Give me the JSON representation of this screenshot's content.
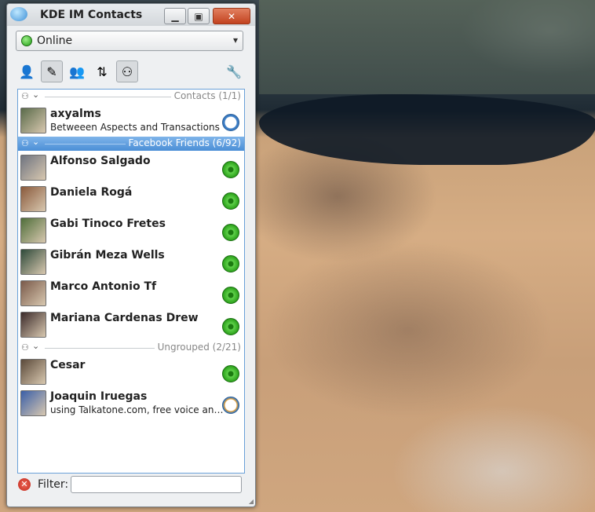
{
  "window": {
    "title": "KDE IM Contacts",
    "min_icon": "minimize-icon",
    "max_icon": "maximize-icon",
    "close_icon": "close-icon"
  },
  "status": {
    "value": "Online",
    "color": "#2ca11b"
  },
  "toolbar": {
    "icons": [
      "add-contact-icon",
      "edit-icon",
      "show-offline-icon",
      "sort-icon",
      "group-view-icon",
      "settings-icon"
    ]
  },
  "groups": [
    {
      "label": "Contacts (1/1)",
      "selected": false,
      "contacts": [
        {
          "name": "axyalms",
          "message": "Betweeen Aspects and Transactions",
          "status": "away",
          "avatar": "#5a6b4a"
        }
      ]
    },
    {
      "label": "Facebook Friends (6/92)",
      "selected": true,
      "contacts": [
        {
          "name": "Alfonso Salgado",
          "message": "",
          "status": "online",
          "avatar": "#6f7480"
        },
        {
          "name": "Daniela Rogá",
          "message": "",
          "status": "online",
          "avatar": "#8a5a3c"
        },
        {
          "name": "Gabi Tinoco Fretes",
          "message": "",
          "status": "online",
          "avatar": "#4f6e3a"
        },
        {
          "name": "Gibrán Meza Wells",
          "message": "",
          "status": "online",
          "avatar": "#2e4a3a"
        },
        {
          "name": "Marco Antonio Tf",
          "message": "",
          "status": "online",
          "avatar": "#7a5a4a"
        },
        {
          "name": "Mariana Cardenas Drew",
          "message": "",
          "status": "online",
          "avatar": "#3b2a2a"
        }
      ]
    },
    {
      "label": "Ungrouped (2/21)",
      "selected": false,
      "contacts": [
        {
          "name": "Cesar",
          "message": "",
          "status": "online",
          "avatar": "#5b4a3a"
        },
        {
          "name": "Joaquin Iruegas",
          "message": "using Talkatone.com, free voice and text for G...",
          "status": "busy",
          "avatar": "#3a5fa8"
        }
      ]
    }
  ],
  "filter": {
    "label": "Filter:",
    "value": ""
  }
}
